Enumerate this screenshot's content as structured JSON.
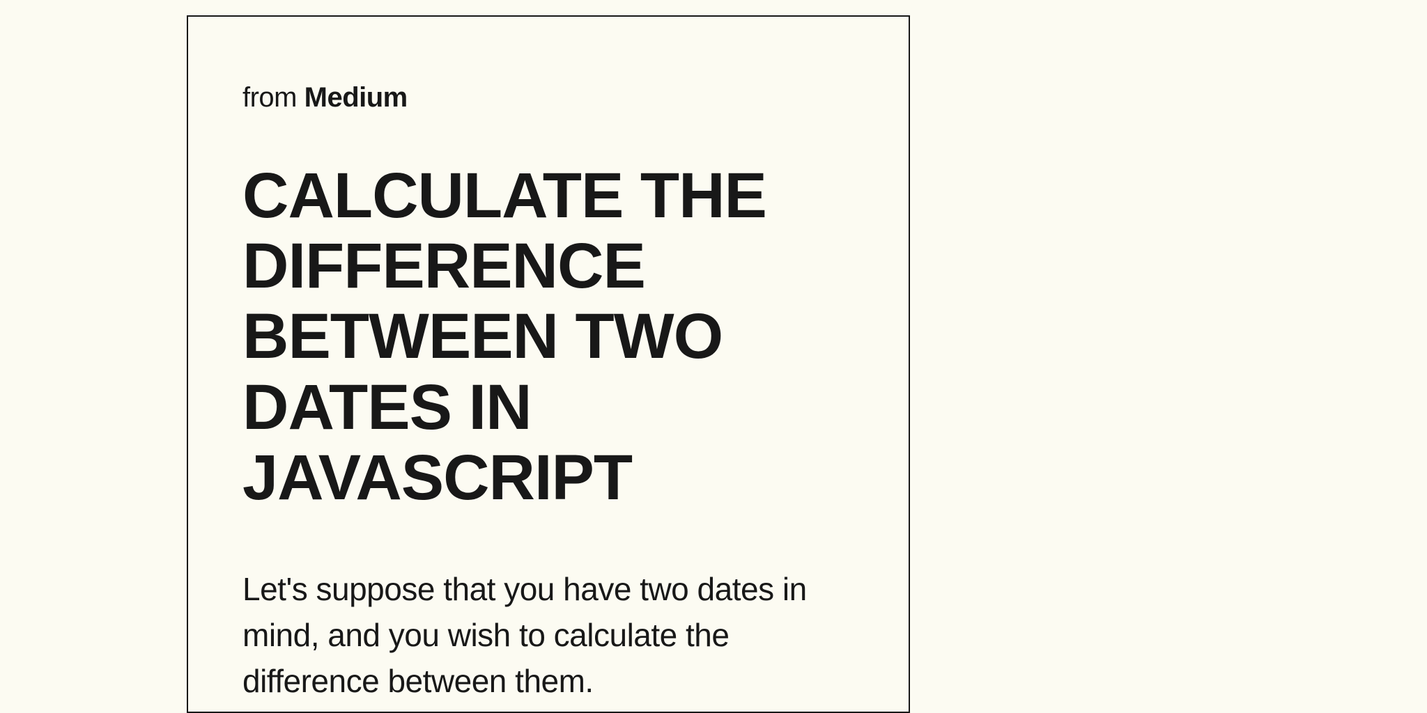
{
  "source": {
    "prefix": "from ",
    "name": "Medium"
  },
  "title": "CALCULATE THE DIFFERENCE BETWEEN TWO DATES IN JAVASCRIPT",
  "body": "Let's suppose that you have two dates in mind, and you wish to calculate the difference between them."
}
